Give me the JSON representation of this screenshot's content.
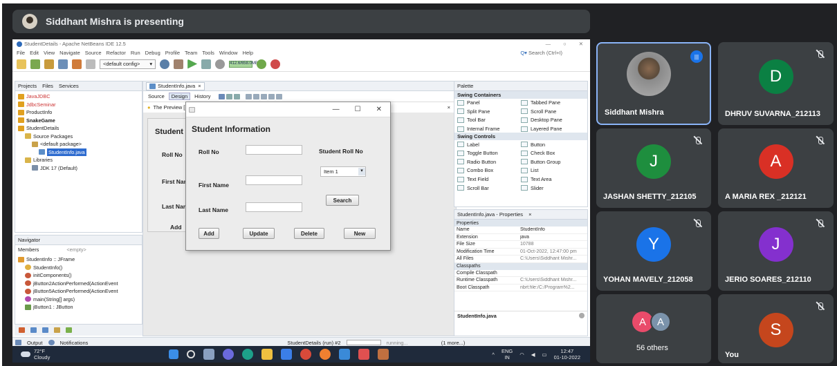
{
  "meet": {
    "presenter_banner": "Siddhant Mishra is presenting",
    "tiles": [
      {
        "name": "Siddhant Mishra",
        "initial": "",
        "color": "#6d6d6d",
        "active": true
      },
      {
        "name": "DHRUV SUVARNA_212113",
        "initial": "D",
        "color": "#0b8043"
      },
      {
        "name": "JASHAN SHETTY_212105",
        "initial": "J",
        "color": "#1e8e3e"
      },
      {
        "name": "A MARIA REX _212121",
        "initial": "A",
        "color": "#d93025"
      },
      {
        "name": "YOHAN MAVELY_212058",
        "initial": "Y",
        "color": "#1a73e8"
      },
      {
        "name": "JERIO SOARES_212110",
        "initial": "J",
        "color": "#8430ce"
      },
      {
        "name": "56 others",
        "initials": [
          "A",
          "A"
        ]
      },
      {
        "name": "You",
        "initial": "S",
        "color": "#c5461d"
      }
    ]
  },
  "ide": {
    "title": "StudentDetails - Apache NetBeans IDE 12.5",
    "menu": [
      "File",
      "Edit",
      "View",
      "Navigate",
      "Source",
      "Refactor",
      "Run",
      "Debug",
      "Profile",
      "Team",
      "Tools",
      "Window",
      "Help"
    ],
    "search": "Search (Ctrl+I)",
    "config": "<default config>",
    "memory": "412.6/658.0MB",
    "projects_tabs": [
      "Projects",
      "Files",
      "Services"
    ],
    "tree": [
      "JavaJDBC",
      "JdbcSeminar",
      "ProductInfo",
      "SnakeGame",
      "StudentDetails",
      "Source Packages",
      "<default package>",
      "StudentInfo.java",
      "Libraries",
      "JDK 17 (Default)"
    ],
    "navigator": {
      "tab": "Navigator",
      "members": "Members",
      "filter": "<empty>",
      "items": [
        "StudentInfo :: JFrame",
        "StudentInfo()",
        "initComponents()",
        "jButton2ActionPerformed(ActionEvent",
        "jButton5ActionPerformed(ActionEvent",
        "main(String[] args)",
        "jButton1 : JButton"
      ]
    },
    "editor": {
      "tab": "StudentInfo.java",
      "subtabs": [
        "Source",
        "Design",
        "History"
      ],
      "preview": "The Preview [",
      "jframe": {
        "heading": "Student",
        "labels": [
          "Roll No",
          "First Nam",
          "Last Nam"
        ],
        "button": "Add"
      }
    },
    "dialog": {
      "heading": "Student Information",
      "roll_label": "Roll No",
      "first_label": "First Name",
      "last_label": "Last Name",
      "srn_label": "Student Roll No",
      "combo": "Item 1",
      "search": "Search",
      "buttons": [
        "Add",
        "Update",
        "Delete",
        "New"
      ]
    },
    "palette": {
      "tab": "Palette",
      "containers_title": "Swing Containers",
      "containers": [
        "Panel",
        "Tabbed Pane",
        "Split Pane",
        "Scroll Pane",
        "Tool Bar",
        "Desktop Pane",
        "Internal Frame",
        "Layered Pane"
      ],
      "controls_title": "Swing Controls",
      "controls": [
        "Label",
        "Button",
        "Toggle Button",
        "Check Box",
        "Radio Button",
        "Button Group",
        "Combo Box",
        "List",
        "Text Field",
        "Text Area",
        "Scroll Bar",
        "Slider"
      ]
    },
    "properties": {
      "tab": "StudentInfo.java - Properties",
      "header": "Properties",
      "rows": [
        {
          "k": "Name",
          "v": "StudentInfo"
        },
        {
          "k": "Extension",
          "v": "java"
        },
        {
          "k": "File Size",
          "v": "10788"
        },
        {
          "k": "Modification Time",
          "v": "01-Oct-2022, 12:47:00 pm"
        },
        {
          "k": "All Files",
          "v": "C:\\Users\\Siddhant Mishr..."
        }
      ],
      "classpaths_header": "Classpaths",
      "cp_rows": [
        {
          "k": "Compile Classpath",
          "v": ""
        },
        {
          "k": "Runtime Classpath",
          "v": "C:\\Users\\Siddhant Mishr..."
        },
        {
          "k": "Boot Classpath",
          "v": "nbrt:file:/C:/Program%2..."
        }
      ],
      "footer": "StudentInfo.java"
    },
    "statusbar": {
      "output": "Output",
      "notifications": "Notifications",
      "run": "StudentDetails (run) #2",
      "running": "running...",
      "more": "(1 more...)"
    }
  },
  "taskbar": {
    "temp": "72°F",
    "weather": "Cloudy",
    "lang1": "ENG",
    "lang2": "IN",
    "time": "12:47",
    "date": "01-10-2022"
  }
}
